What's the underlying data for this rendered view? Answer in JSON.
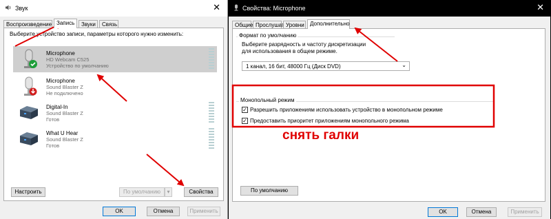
{
  "sound_window": {
    "title": "Звук",
    "tabs": [
      "Воспроизведение",
      "Запись",
      "Звуки",
      "Связь"
    ],
    "active_tab": 1,
    "instruction": "Выберите устройство записи, параметры которого нужно изменить:",
    "devices": [
      {
        "name": "Microphone",
        "line1": "HD Webcam C525",
        "line2": "Устройство по умолчанию",
        "icon": "microphone-icon",
        "status": "default",
        "selected": true
      },
      {
        "name": "Microphone",
        "line1": "Sound Blaster Z",
        "line2": "Не подключено",
        "icon": "microphone-icon",
        "status": "disconnected",
        "selected": false
      },
      {
        "name": "Digital-In",
        "line1": "Sound Blaster Z",
        "line2": "Готов",
        "icon": "sound-card-icon",
        "status": "ready",
        "selected": false
      },
      {
        "name": "What U Hear",
        "line1": "Sound Blaster Z",
        "line2": "Готов",
        "icon": "sound-card-icon",
        "status": "ready",
        "selected": false
      }
    ],
    "configure_button": "Настроить",
    "set_default_button": "По умолчанию",
    "properties_button": "Свойства",
    "ok_button": "OK",
    "cancel_button": "Отмена",
    "apply_button": "Применить"
  },
  "props_window": {
    "title": "Свойства: Microphone",
    "tabs": [
      "Общие",
      "Прослушать",
      "Уровни",
      "Дополнительно"
    ],
    "active_tab": 3,
    "default_format_group": "Формат по умолчанию",
    "default_format_desc": "Выберите разрядность и частоту дискретизации для использования в общем режиме.",
    "format_value": "1 канал, 16 бит, 48000 Гц (Диск DVD)",
    "exclusive_group": "Монопольный режим",
    "exclusive_allow": "Разрешить приложениям использовать устройство в монопольном режиме",
    "exclusive_priority": "Предоставить приоритет приложениям монопольного режима",
    "exclusive_allow_checked": true,
    "exclusive_priority_checked": true,
    "restore_default_button": "По умолчанию",
    "ok_button": "OK",
    "cancel_button": "Отмена",
    "apply_button": "Применить"
  },
  "annotation": {
    "text": "снять галки",
    "color": "#e00000"
  }
}
